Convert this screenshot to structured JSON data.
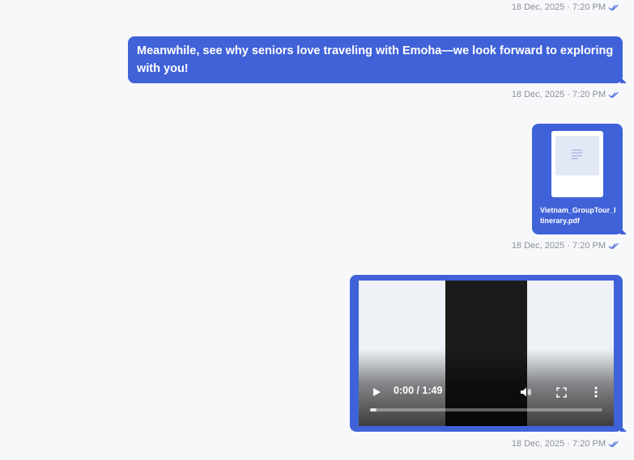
{
  "messages": [
    {
      "type": "meta-only",
      "timestamp": "18 Dec, 2025 · 7:20 PM"
    },
    {
      "type": "text",
      "text": "Meanwhile, see why seniors love traveling with Emoha—we look forward to exploring with you!",
      "timestamp": "18 Dec, 2025 · 7:20 PM"
    },
    {
      "type": "file",
      "file_name": "Vietnam_GroupTour_Itinerary.pdf",
      "icon": "document-icon",
      "timestamp": "18 Dec, 2025 · 7:20 PM"
    },
    {
      "type": "video",
      "time_display": "0:00 / 1:49",
      "progress": 0.0,
      "timestamp": "18 Dec, 2025 · 7:20 PM"
    }
  ],
  "colors": {
    "bubble": "#4062d8",
    "timestamp": "#8b8f98",
    "read_ticks": "#4062d8"
  },
  "icons": {
    "read_status": "double-check-icon",
    "play": "play-icon",
    "volume": "volume-icon",
    "fullscreen": "fullscreen-icon",
    "more": "more-vertical-icon"
  }
}
